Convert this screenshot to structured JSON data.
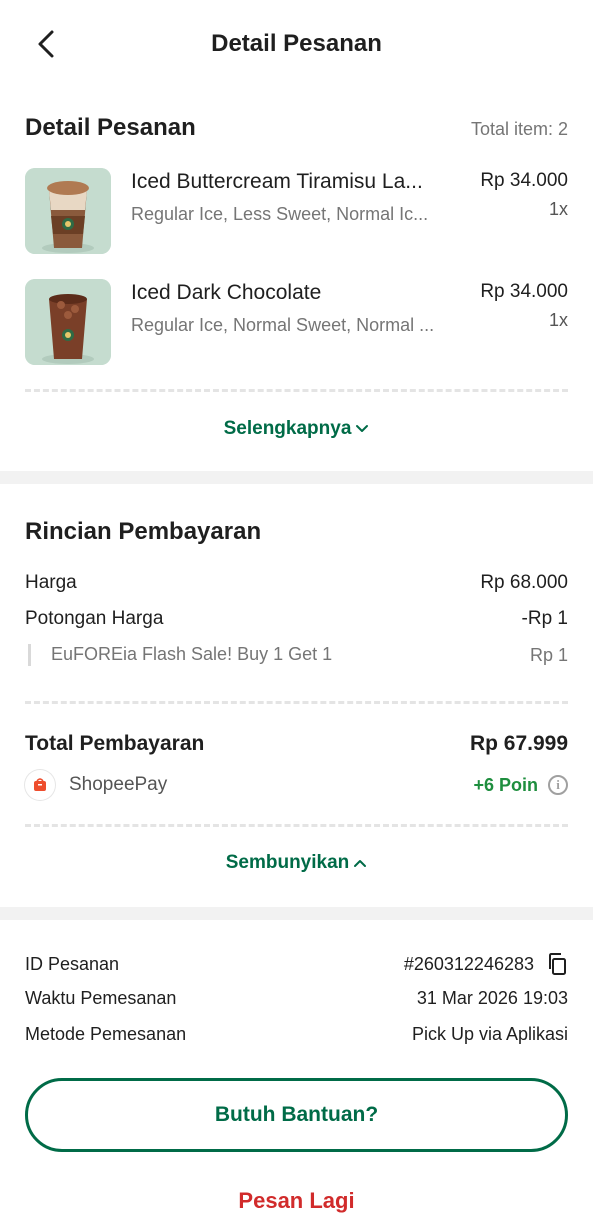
{
  "header": {
    "title": "Detail Pesanan"
  },
  "order": {
    "section_title": "Detail Pesanan",
    "total_items": "Total item: 2",
    "items": [
      {
        "name": "Iced Buttercream Tiramisu La...",
        "desc": "Regular Ice, Less Sweet, Normal Ic...",
        "price": "Rp 34.000",
        "qty": "1x"
      },
      {
        "name": "Iced Dark Chocolate",
        "desc": "Regular Ice, Normal Sweet, Normal ...",
        "price": "Rp 34.000",
        "qty": "1x"
      }
    ],
    "more_label": "Selengkapnya"
  },
  "payment": {
    "section_title": "Rincian Pembayaran",
    "price_label": "Harga",
    "price_value": "Rp 68.000",
    "discount_label": "Potongan Harga",
    "discount_value": "-Rp 1",
    "promo_label": "EuFOREia Flash Sale! Buy 1 Get 1",
    "promo_value": "Rp 1",
    "total_label": "Total Pembayaran",
    "total_value": "Rp 67.999",
    "method_name": "ShopeePay",
    "points": "+6 Poin",
    "hide_label": "Sembunyikan"
  },
  "info": {
    "order_id_label": "ID Pesanan",
    "order_id_value": "#260312246283",
    "time_label": "Waktu Pemesanan",
    "time_value": "31 Mar 2026 19:03",
    "method_label": "Metode Pemesanan",
    "method_value": "Pick Up via Aplikasi",
    "help_label": "Butuh Bantuan?",
    "reorder_label": "Pesan Lagi"
  },
  "colors": {
    "brand_green": "#006b47",
    "positive_green": "#1e8e3e",
    "danger_red": "#d12b2b"
  }
}
